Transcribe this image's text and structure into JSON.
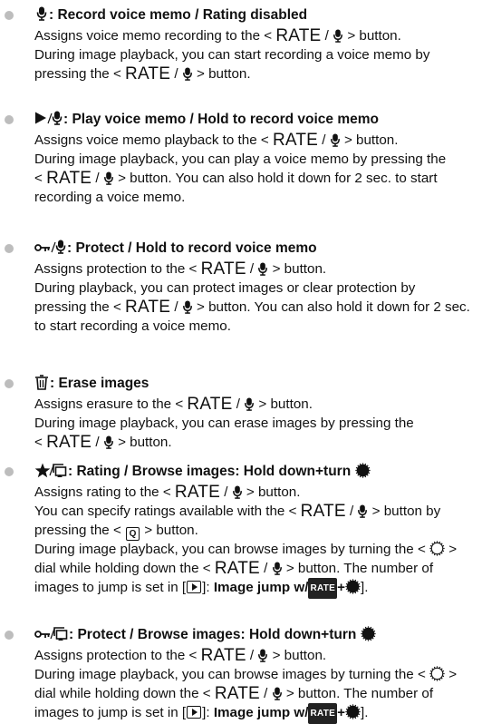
{
  "symbols": {
    "rate": "RATE",
    "rate_badge": "RATE",
    "q": "Q"
  },
  "items": [
    {
      "icon": "microphone-icon",
      "title": ": Record voice memo / Rating disabled",
      "lines": [
        [
          "Assigns voice memo recording to the < ",
          "RATE",
          " / ",
          "mic",
          " > button."
        ],
        [
          "During image playback, you can start recording a voice memo by"
        ],
        [
          "pressing the < ",
          "RATE",
          " / ",
          "mic",
          " > button."
        ]
      ]
    },
    {
      "icon": "play-mic-icon",
      "title": ": Play voice memo / Hold to record voice memo",
      "lines": [
        [
          "Assigns voice memo playback to the < ",
          "RATE",
          " / ",
          "mic",
          " > button."
        ],
        [
          "During image playback, you can play a voice memo by pressing the"
        ],
        [
          "< ",
          "RATE",
          " / ",
          "mic",
          " > button. You can also hold it down for 2 sec. to start"
        ],
        [
          "recording a voice memo."
        ]
      ]
    },
    {
      "icon": "protect-mic-icon",
      "title": ": Protect / Hold to record voice memo",
      "lines": [
        [
          "Assigns protection to the < ",
          "RATE",
          " / ",
          "mic",
          " > button."
        ],
        [
          "During playback, you can protect images or clear protection by"
        ],
        [
          "pressing the < ",
          "RATE",
          " / ",
          "mic",
          " > button. You can also hold it down for 2 sec."
        ],
        [
          "to start recording a voice memo."
        ]
      ]
    },
    {
      "icon": "trash-icon",
      "title": ": Erase images",
      "lines": [
        [
          "Assigns erasure to the < ",
          "RATE",
          " / ",
          "mic",
          " > button."
        ],
        [
          "During image playback, you can erase images by pressing the"
        ],
        [
          "< ",
          "RATE",
          " / ",
          "mic",
          " > button."
        ]
      ]
    },
    {
      "icon": "star-browse-icon",
      "title": ": Rating / Browse images: Hold down+turn",
      "lines": [
        [
          "Assigns rating to the < ",
          "RATE",
          " / ",
          "mic",
          " > button."
        ],
        [
          "You can specify ratings available with the < ",
          "RATE",
          " / ",
          "mic",
          " > button by"
        ],
        [
          "pressing the < ",
          "QBOX",
          " > button."
        ],
        [
          "During image playback, you can browse images by turning the < ",
          "DIAL",
          " >"
        ],
        [
          "dial while holding down the < ",
          "RATE",
          " / ",
          "mic",
          " > button. The number of"
        ],
        [
          "images to jump is set in [",
          "PLAYBOX",
          "]: ",
          "BOLD:Image jump w/",
          "BADGE",
          "BOLD:+",
          "DIAL",
          "]."
        ]
      ]
    },
    {
      "icon": "protect-browse-icon",
      "title": ": Protect / Browse images: Hold down+turn",
      "lines": [
        [
          "Assigns protection to the < ",
          "RATE",
          " / ",
          "mic",
          " > button."
        ],
        [
          "During image playback, you can browse images by turning the < ",
          "DIAL",
          " >"
        ],
        [
          "dial while holding down the < ",
          "RATE",
          " / ",
          "mic",
          " > button. The number of"
        ],
        [
          "images to jump is set in [",
          "PLAYBOX",
          "]: ",
          "BOLD:Image jump w/",
          "BADGE",
          "BOLD:+",
          "DIAL",
          "]."
        ]
      ]
    }
  ]
}
